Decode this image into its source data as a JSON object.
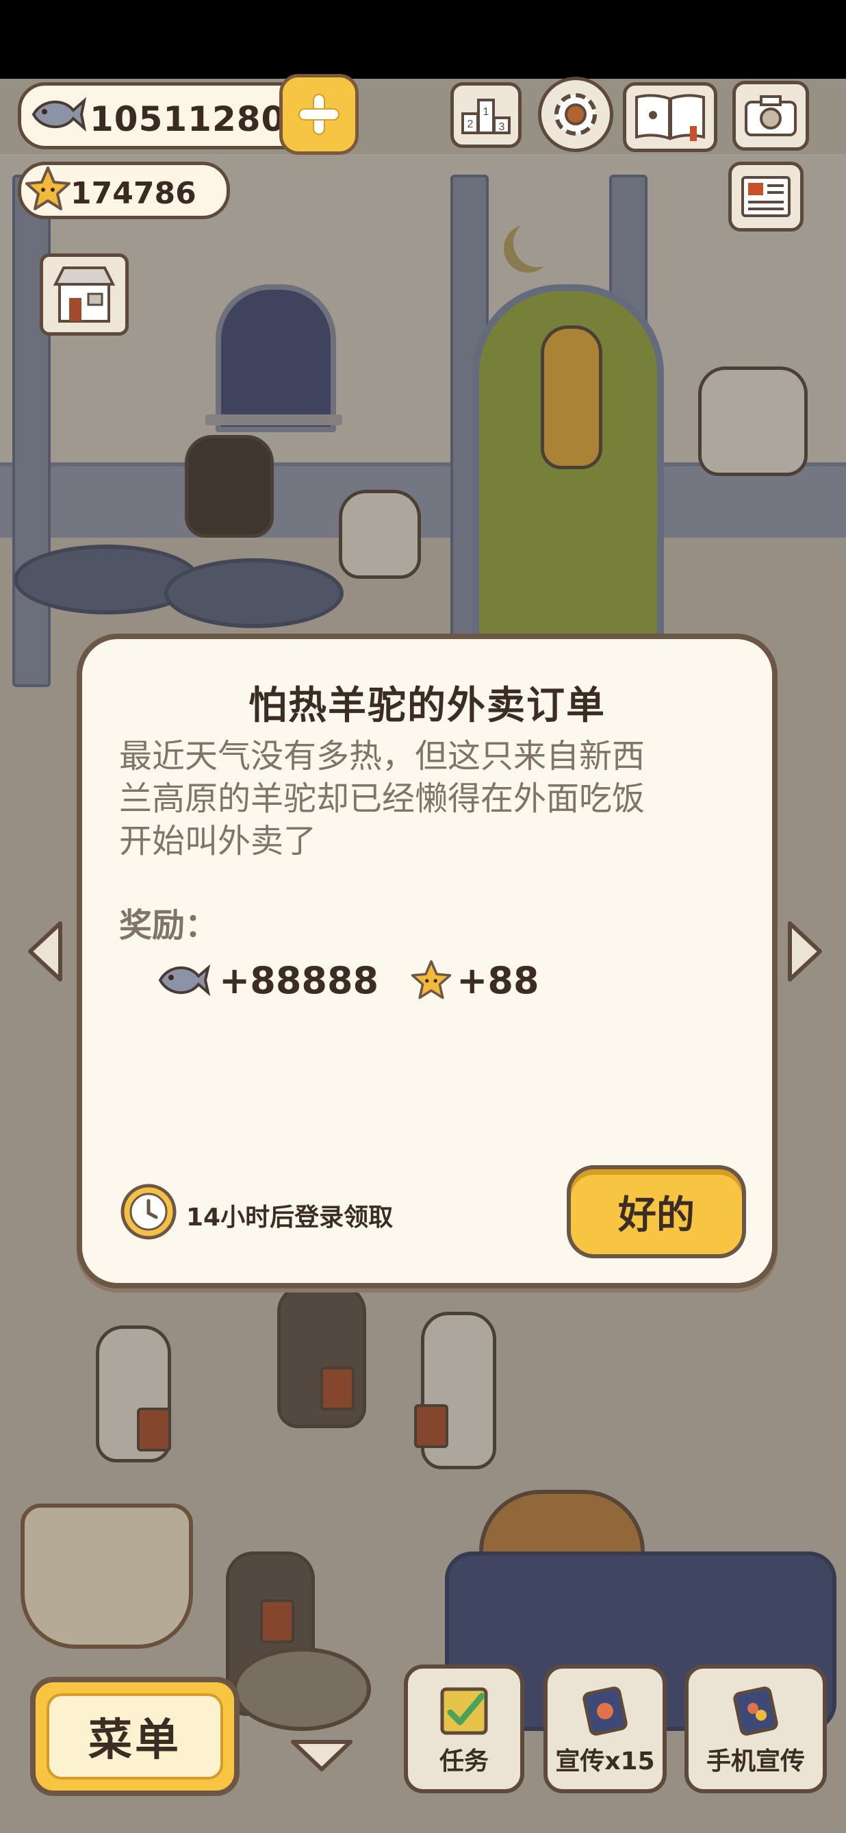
{
  "hud": {
    "coins": "10511280",
    "stars": "174786"
  },
  "dialog": {
    "title": "怕热羊驼的外卖订单",
    "description_lines": [
      "最近天气没有多热，但这只来自新西",
      "兰高原的羊驼却已经懒得在外面吃饭",
      "开始叫外卖了"
    ],
    "reward_label": "奖励：",
    "rewards": {
      "fish_amount": "+88888",
      "star_amount": "+88"
    },
    "timer_text": "14小时后登录领取",
    "ok_label": "好的"
  },
  "bottom_bar": {
    "menu_label": "菜单",
    "task_label": "任务",
    "promo_label": "宣传x15",
    "phone_promo_label": "手机宣传"
  },
  "icons": [
    "fish-icon",
    "plus-icon",
    "star-icon",
    "rank-icon",
    "gear-icon",
    "book-icon",
    "camera-icon",
    "newspaper-icon",
    "shop-icon",
    "timer-icon",
    "left-arrow-icon",
    "right-arrow-icon",
    "chevron-down-icon",
    "checklist-icon",
    "promo-card-icon",
    "phone-card-icon"
  ],
  "colors": {
    "accent": "#f7c542",
    "dialog_bg": "#fdf8ee",
    "border": "#6c5645",
    "text_dark": "#3c2d24",
    "text_muted": "#7f7466"
  }
}
